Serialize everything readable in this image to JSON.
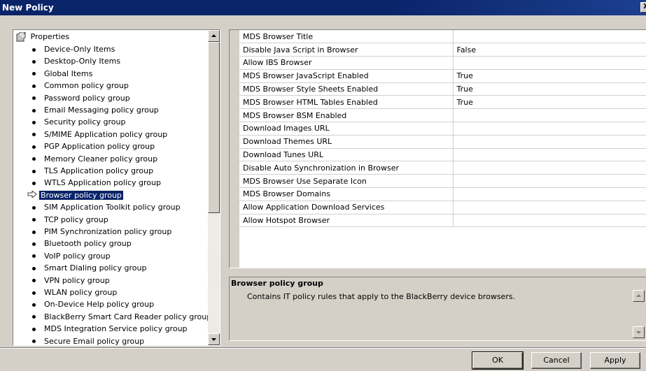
{
  "window": {
    "title": "New Policy",
    "close_label": "X"
  },
  "tree": {
    "root_label": "Properties",
    "items": [
      {
        "label": "Device-Only Items"
      },
      {
        "label": "Desktop-Only Items"
      },
      {
        "label": "Global Items"
      },
      {
        "label": "Common policy group"
      },
      {
        "label": "Password policy group"
      },
      {
        "label": "Email Messaging policy group"
      },
      {
        "label": "Security policy group"
      },
      {
        "label": "S/MIME Application policy group"
      },
      {
        "label": "PGP Application policy group"
      },
      {
        "label": "Memory Cleaner policy group"
      },
      {
        "label": "TLS Application policy group"
      },
      {
        "label": "WTLS Application policy group"
      },
      {
        "label": "Browser policy group",
        "selected": true
      },
      {
        "label": "SIM Application Toolkit policy group"
      },
      {
        "label": "TCP policy group"
      },
      {
        "label": "PIM Synchronization policy group"
      },
      {
        "label": "Bluetooth policy group"
      },
      {
        "label": "VoIP policy group"
      },
      {
        "label": "Smart Dialing policy group"
      },
      {
        "label": "VPN policy group"
      },
      {
        "label": "WLAN policy group"
      },
      {
        "label": "On-Device Help policy group"
      },
      {
        "label": "BlackBerry Smart Card Reader policy group"
      },
      {
        "label": "MDS Integration Service policy group"
      },
      {
        "label": "Secure Email policy group"
      }
    ]
  },
  "properties": [
    {
      "name": "MDS Browser Title",
      "value": ""
    },
    {
      "name": "Disable Java Script in Browser",
      "value": "False"
    },
    {
      "name": "Allow IBS Browser",
      "value": ""
    },
    {
      "name": "MDS Browser JavaScript Enabled",
      "value": "True"
    },
    {
      "name": "MDS Browser Style Sheets Enabled",
      "value": "True"
    },
    {
      "name": "MDS Browser HTML Tables Enabled",
      "value": "True"
    },
    {
      "name": "MDS Browser BSM Enabled",
      "value": ""
    },
    {
      "name": "Download Images URL",
      "value": ""
    },
    {
      "name": "Download Themes URL",
      "value": ""
    },
    {
      "name": "Download Tunes URL",
      "value": ""
    },
    {
      "name": "Disable Auto Synchronization in Browser",
      "value": ""
    },
    {
      "name": "MDS Browser Use Separate Icon",
      "value": ""
    },
    {
      "name": "MDS Browser Domains",
      "value": ""
    },
    {
      "name": "Allow Application Download Services",
      "value": ""
    },
    {
      "name": "Allow Hotspot Browser",
      "value": ""
    }
  ],
  "description": {
    "title": "Browser policy group",
    "text": "Contains IT policy rules that apply to the BlackBerry device browsers."
  },
  "buttons": {
    "ok": "OK",
    "cancel": "Cancel",
    "apply": "Apply"
  }
}
